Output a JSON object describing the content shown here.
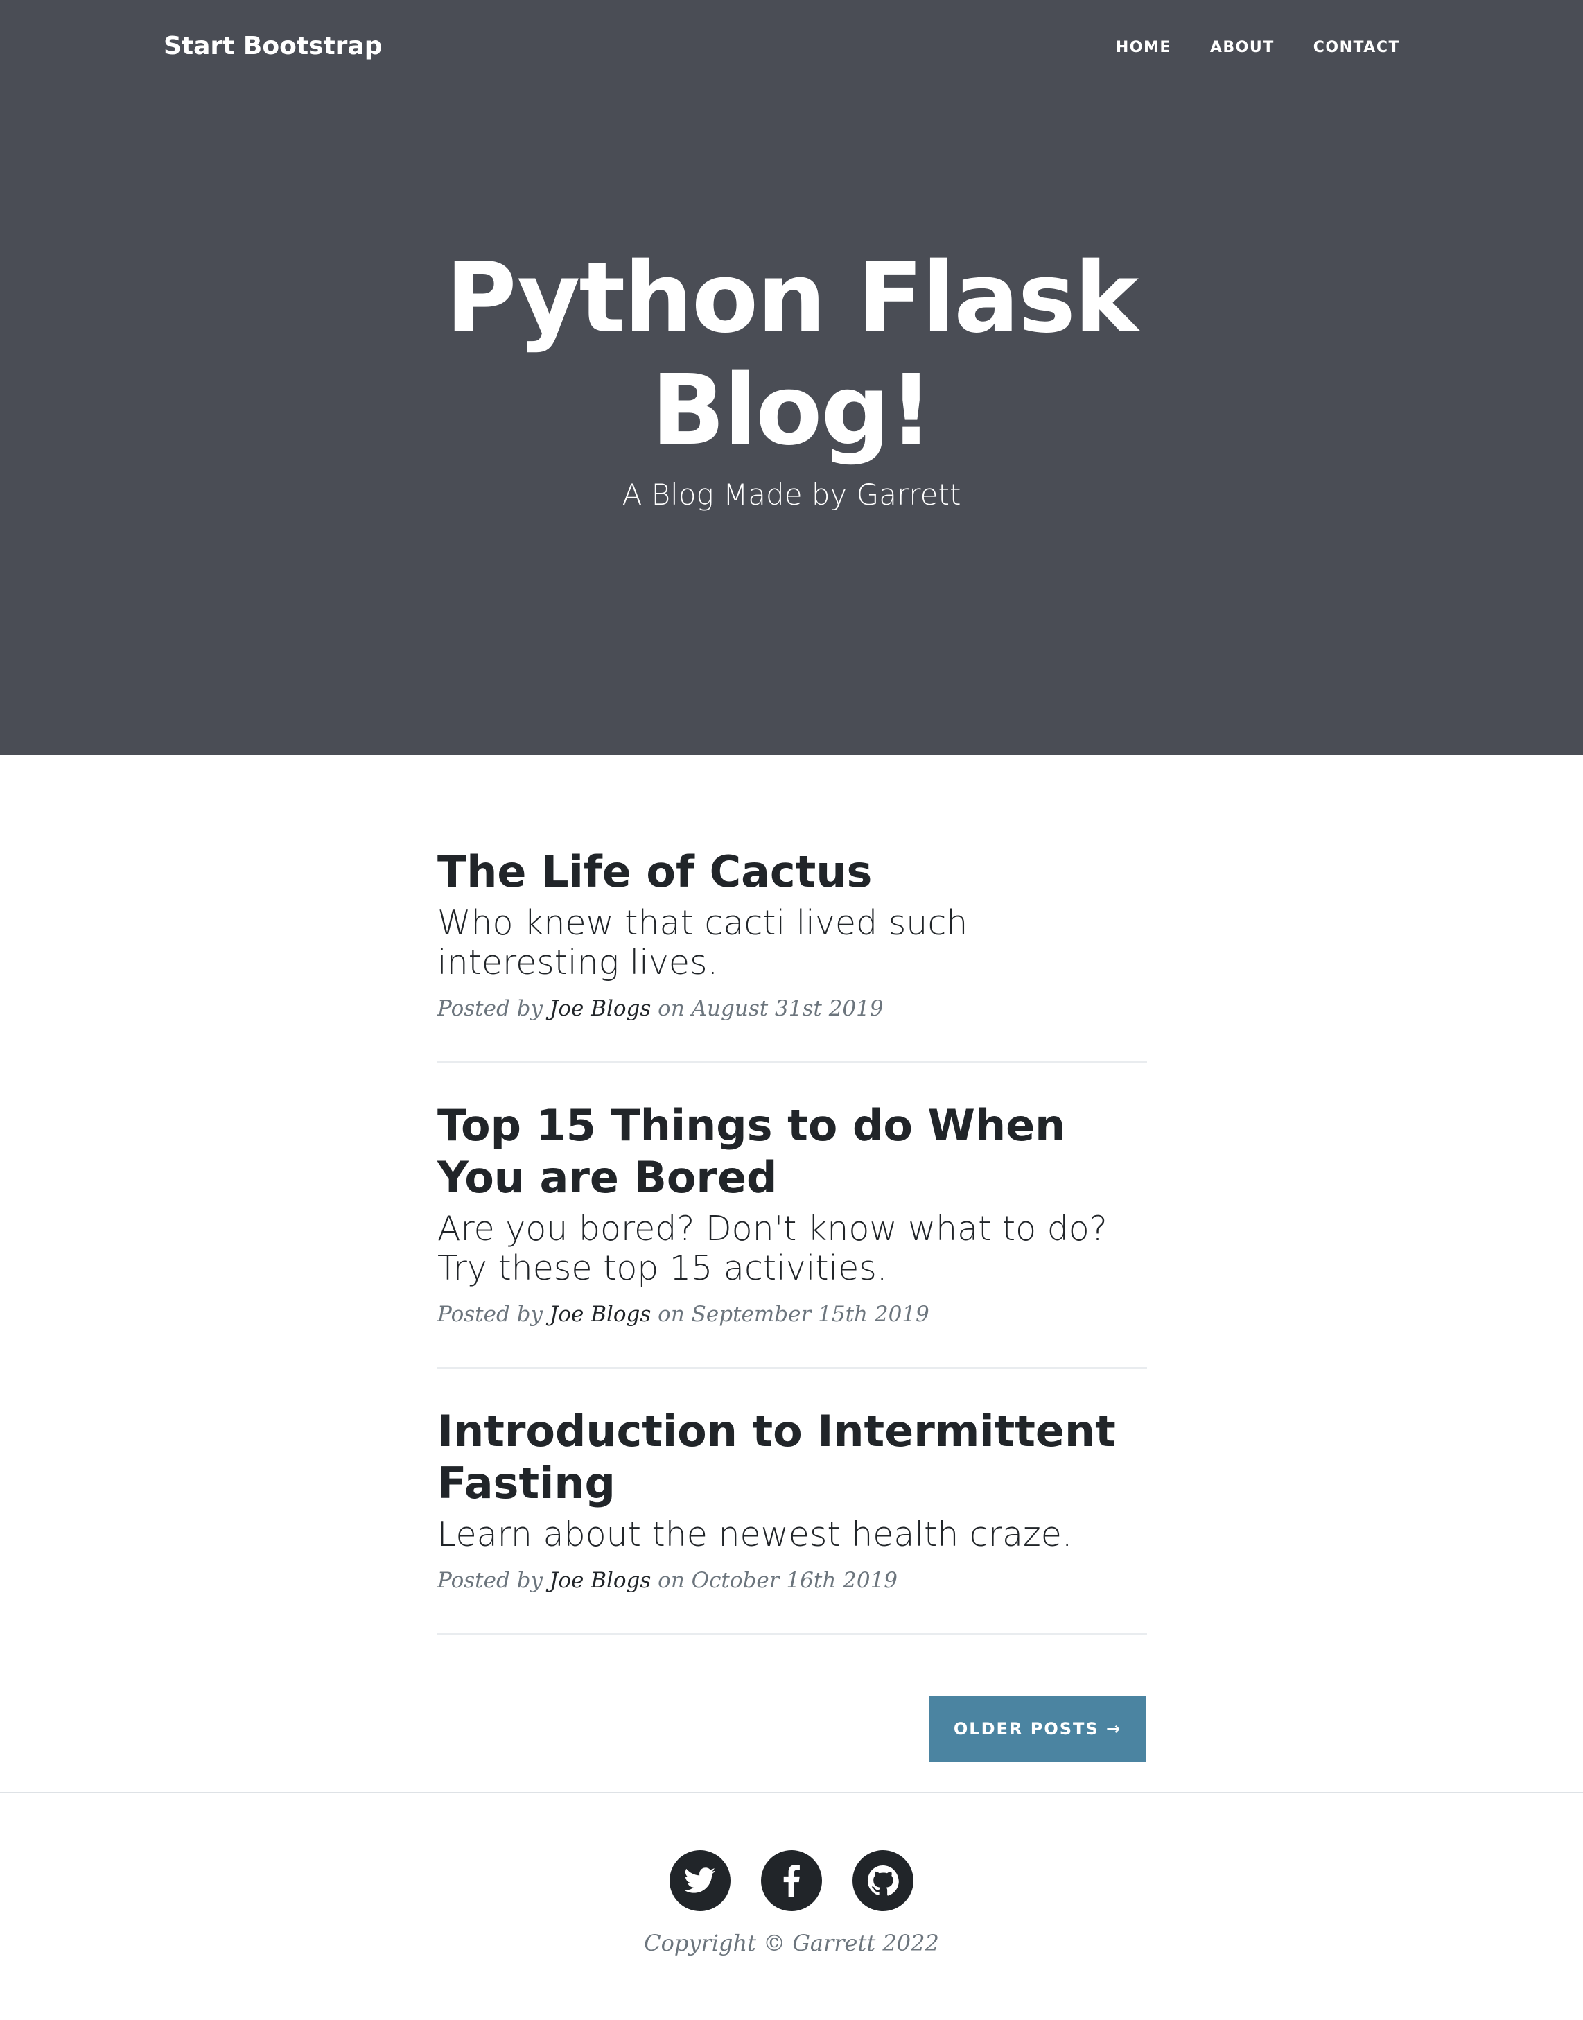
{
  "navbar": {
    "brand": "Start Bootstrap",
    "links": [
      "HOME",
      "ABOUT",
      "CONTACT"
    ]
  },
  "hero": {
    "title": "Python Flask Blog!",
    "subtitle": "A Blog Made by Garrett"
  },
  "posts": [
    {
      "title": "The Life of Cactus",
      "subtitle": "Who knew that cacti lived such interesting lives.",
      "meta_prefix": "Posted by",
      "author": "Joe Blogs",
      "meta_date": "on August 31st 2019"
    },
    {
      "title": "Top 15 Things to do When You are Bored",
      "subtitle": "Are you bored? Don't know what to do? Try these top 15 activities.",
      "meta_prefix": "Posted by",
      "author": "Joe Blogs",
      "meta_date": "on September 15th 2019"
    },
    {
      "title": "Introduction to Intermittent Fasting",
      "subtitle": "Learn about the newest health craze.",
      "meta_prefix": "Posted by",
      "author": "Joe Blogs",
      "meta_date": "on October 16th 2019"
    }
  ],
  "pager": {
    "older_label": "OLDER POSTS →"
  },
  "footer": {
    "socials": [
      "twitter-icon",
      "facebook-icon",
      "github-icon"
    ],
    "copyright": "Copyright © Garrett 2022"
  },
  "colors": {
    "masthead": "#4a4d55",
    "accent": "#4b84a1",
    "text": "#212529",
    "muted": "#6c757d"
  }
}
